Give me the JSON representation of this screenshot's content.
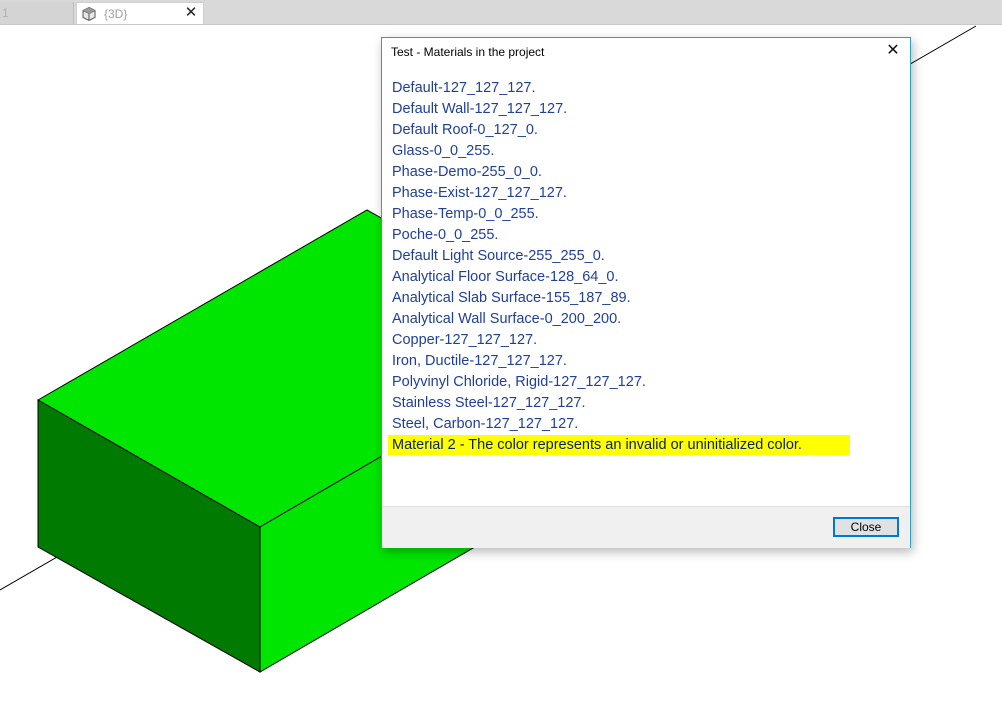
{
  "tabs": [
    {
      "label": "1"
    },
    {
      "label": "{3D}"
    }
  ],
  "dialog": {
    "title": "Test - Materials in the project",
    "close_button_label": "Close",
    "materials": [
      "Default-127_127_127.",
      "Default Wall-127_127_127.",
      "Default Roof-0_127_0.",
      "Glass-0_0_255.",
      "Phase-Demo-255_0_0.",
      "Phase-Exist-127_127_127.",
      "Phase-Temp-0_0_255.",
      "Poche-0_0_255.",
      "Default Light Source-255_255_0.",
      "Analytical Floor Surface-128_64_0.",
      "Analytical Slab Surface-155_187_89.",
      "Analytical Wall Surface-0_200_200.",
      "Copper-127_127_127.",
      "Iron, Ductile-127_127_127.",
      "Polyvinyl Chloride, Rigid-127_127_127.",
      "Stainless Steel-127_127_127.",
      "Steel, Carbon-127_127_127.",
      "Material 2 - The color represents an invalid or uninitialized color."
    ],
    "highlighted_index": 17
  },
  "colors": {
    "box_top": "#00e600",
    "box_front": "#00e600",
    "box_side": "#007a00",
    "highlight": "#ffff00",
    "list_text": "#1f3f9a",
    "dialog_border": "#2f9fbf"
  },
  "icons": {
    "tab_3d": "3d-view-cube-icon",
    "tab_close": "close-icon",
    "dialog_close": "close-icon"
  }
}
